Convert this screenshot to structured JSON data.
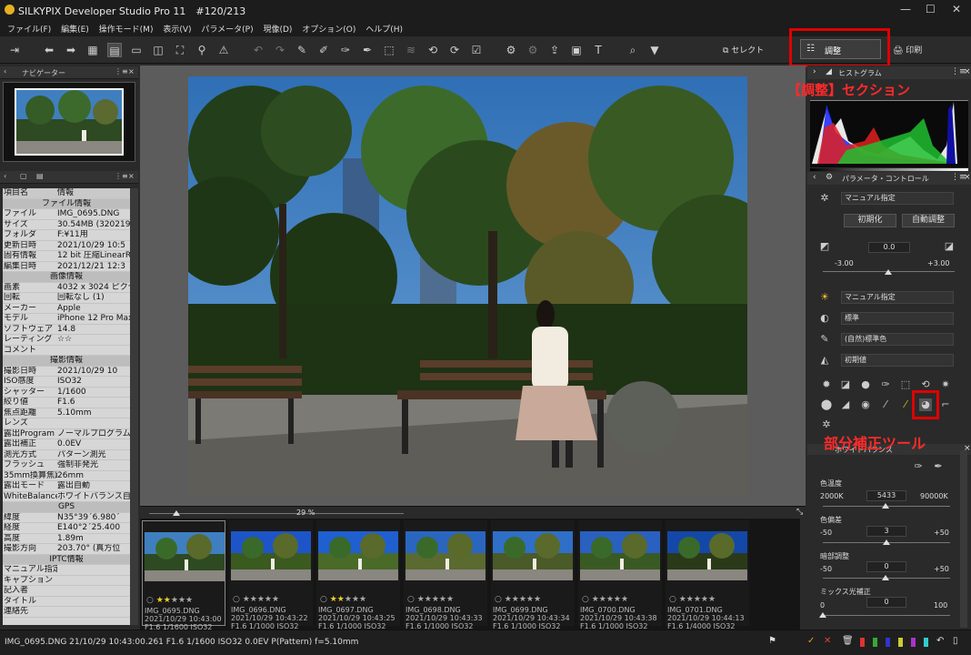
{
  "window": {
    "title": "SILKYPIX Developer Studio Pro 11　#120/213"
  },
  "menu": [
    "ファイル(F)",
    "編集(E)",
    "操作モード(M)",
    "表示(V)",
    "パラメータ(P)",
    "現像(D)",
    "オプション(O)",
    "ヘルプ(H)"
  ],
  "toolbar": {
    "select_label": "セレクト",
    "adjust_label": "調整",
    "print_label": "印刷"
  },
  "annotations": {
    "adjust_section": "【調整】セクション",
    "local_tool": "部分補正ツール"
  },
  "navigator": {
    "title": "ナビゲーター"
  },
  "info": {
    "header": [
      "項目名",
      "情報"
    ],
    "rows": [
      {
        "s": "ファイル情報"
      },
      {
        "k": "ファイル",
        "v": "IMG_0695.DNG"
      },
      {
        "k": "サイズ",
        "v": "30.54MB (320219"
      },
      {
        "k": "フォルダ",
        "v": "F:¥11用"
      },
      {
        "k": "更新日時",
        "v": "2021/10/29 10:5"
      },
      {
        "k": "固有情報",
        "v": "12 bit 圧縮LinearR"
      },
      {
        "k": "編集日時",
        "v": "2021/12/21 12:3"
      },
      {
        "s": "画像情報"
      },
      {
        "k": "画素",
        "v": "4032 x 3024 ピクセ"
      },
      {
        "k": "回転",
        "v": "回転なし (1)"
      },
      {
        "k": "メーカー",
        "v": "Apple"
      },
      {
        "k": "モデル",
        "v": "iPhone 12 Pro Max"
      },
      {
        "k": "ソフトウェア",
        "v": "14.8"
      },
      {
        "k": "レーティング",
        "v": "☆☆"
      },
      {
        "k": "コメント",
        "v": ""
      },
      {
        "s": "撮影情報"
      },
      {
        "k": "撮影日時",
        "v": "2021/10/29 10"
      },
      {
        "k": "ISO感度",
        "v": "ISO32"
      },
      {
        "k": "シャッター",
        "v": "1/1600"
      },
      {
        "k": "絞り値",
        "v": "F1.6"
      },
      {
        "k": "焦点距離",
        "v": "5.10mm"
      },
      {
        "k": "レンズ",
        "v": ""
      },
      {
        "k": "露出Program",
        "v": "ノーマルプログラム"
      },
      {
        "k": "露出補正",
        "v": "0.0EV"
      },
      {
        "k": "測光方式",
        "v": "パターン測光"
      },
      {
        "k": "フラッシュ",
        "v": "強制非発光"
      },
      {
        "k": "35mm換算焦距",
        "v": "26mm"
      },
      {
        "k": "露出モード",
        "v": "露出自動"
      },
      {
        "k": "WhiteBalance",
        "v": "ホワイトバランス自動"
      },
      {
        "s": "GPS"
      },
      {
        "k": "緯度",
        "v": "N35°39´6.980´"
      },
      {
        "k": "経度",
        "v": "E140°2´25.400"
      },
      {
        "k": "高度",
        "v": "1.89m"
      },
      {
        "k": "撮影方向",
        "v": "203.70° (真方位"
      },
      {
        "s": "IPTC情報"
      },
      {
        "k": "マニュアル指定",
        "v": ""
      },
      {
        "k": "キャプション",
        "v": ""
      },
      {
        "k": "記入者",
        "v": ""
      },
      {
        "k": "タイトル",
        "v": ""
      },
      {
        "k": "連絡先",
        "v": ""
      }
    ]
  },
  "zoom": "29 %",
  "filmstrip": [
    {
      "name": "IMG_0695.DNG",
      "date": "2021/10/29 10:43:00",
      "exif": "F1.6 1/1600 ISO32",
      "stars": 2
    },
    {
      "name": "IMG_0696.DNG",
      "date": "2021/10/29 10:43:22",
      "exif": "F1.6 1/1000 ISO32",
      "stars": 0
    },
    {
      "name": "IMG_0697.DNG",
      "date": "2021/10/29 10:43:25",
      "exif": "F1.6 1/1000 ISO32",
      "stars": 2
    },
    {
      "name": "IMG_0698.DNG",
      "date": "2021/10/29 10:43:33",
      "exif": "F1.6 1/1000 ISO32",
      "stars": 0
    },
    {
      "name": "IMG_0699.DNG",
      "date": "2021/10/29 10:43:34",
      "exif": "F1.6 1/1000 ISO32",
      "stars": 0
    },
    {
      "name": "IMG_0700.DNG",
      "date": "2021/10/29 10:43:38",
      "exif": "F1.6 1/1000 ISO32",
      "stars": 0
    },
    {
      "name": "IMG_0701.DNG",
      "date": "2021/10/29 10:44:13",
      "exif": "F1.6 1/4000 ISO32",
      "stars": 0
    }
  ],
  "histogram": {
    "title": "ヒストグラム"
  },
  "params": {
    "title": "パラメータ・コントロール",
    "preset": "マニュアル指定",
    "init_label": "初期化",
    "auto_label": "自動調整",
    "exposure": {
      "value": "0.0",
      "min": "-3.00",
      "max": "+3.00"
    },
    "wb_mode": "マニュアル指定",
    "tone": "標準",
    "color": "(自然)標準色",
    "sharp": "初期値",
    "wb_title": "ホワイトバランス",
    "temp": {
      "label": "色温度",
      "min": "2000K",
      "value": "5433",
      "max": "90000K"
    },
    "tint": {
      "label": "色偏差",
      "min": "-50",
      "value": "3",
      "max": "+50"
    },
    "dark": {
      "label": "暗部調整",
      "min": "-50",
      "value": "0",
      "max": "+50"
    },
    "mix": {
      "label": "ミックス光補正",
      "min": "0",
      "value": "0",
      "max": "100"
    }
  },
  "status": "IMG_0695.DNG 21/10/29 10:43:00.261 F1.6 1/1600 ISO32  0.0EV P(Pattern) f=5.10mm"
}
